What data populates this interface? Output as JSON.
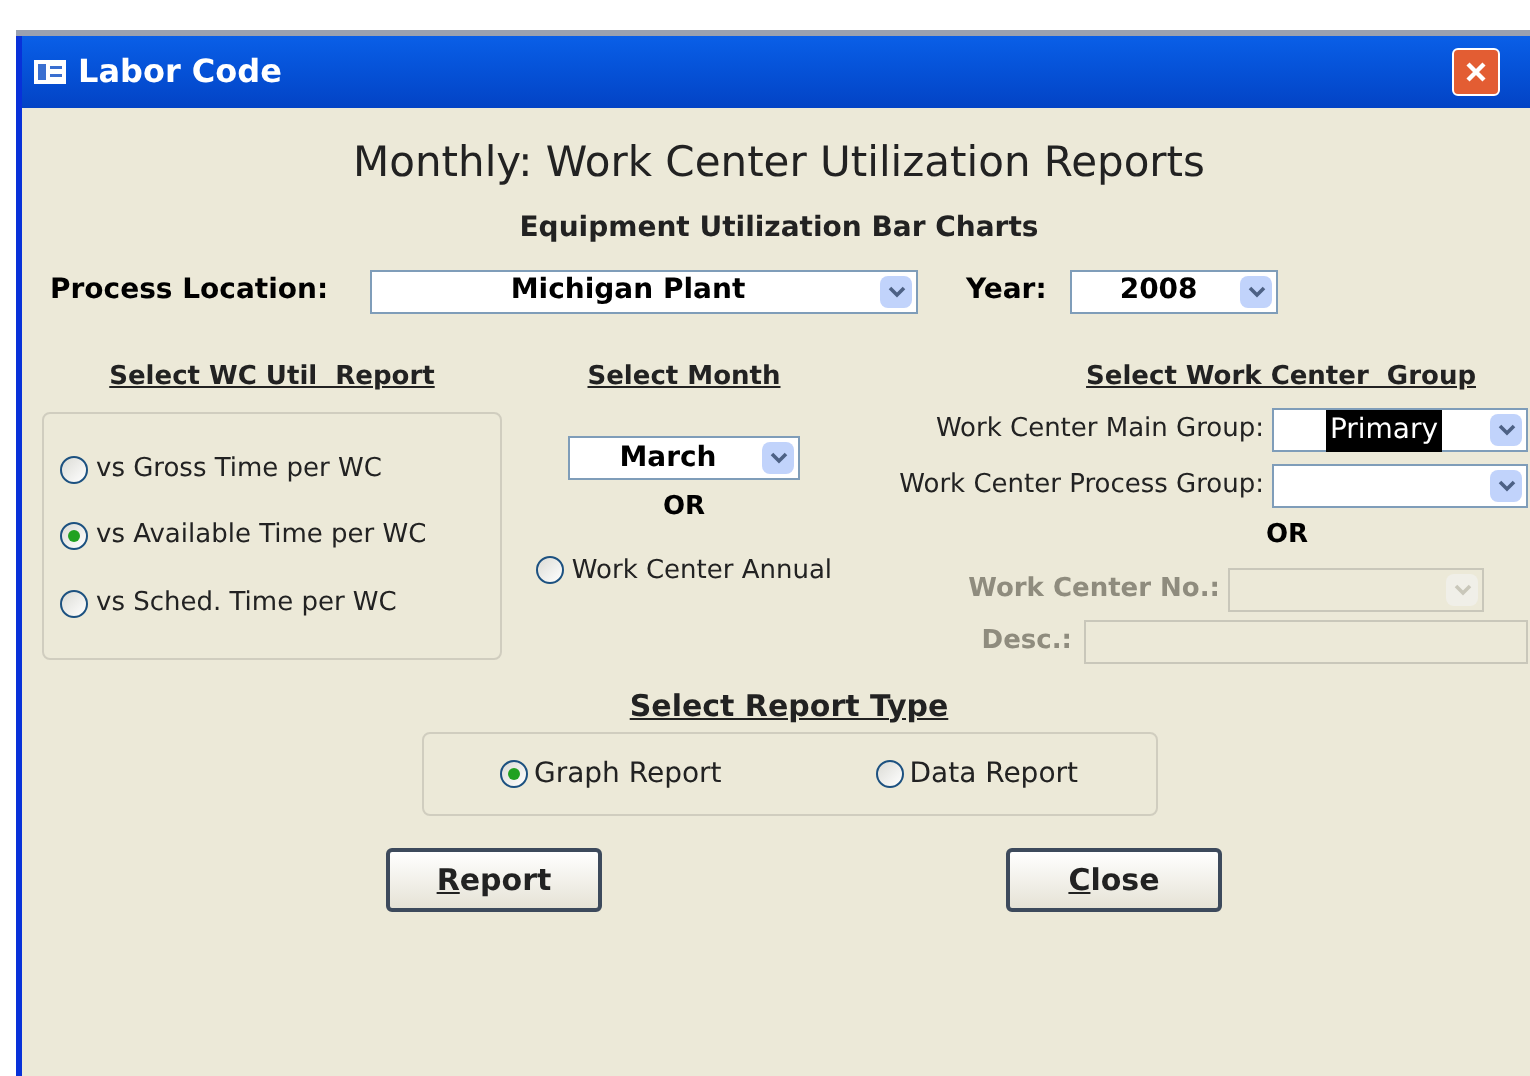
{
  "window": {
    "title": "Labor Code"
  },
  "heading": "Monthly: Work Center Utilization Reports",
  "subheading": "Equipment Utilization Bar Charts",
  "process_location": {
    "label": "Process Location:",
    "value": "Michigan Plant"
  },
  "year": {
    "label": "Year:",
    "value": "2008"
  },
  "wc_util_report": {
    "title": "Select WC Util  Report",
    "options": [
      {
        "label": "vs Gross Time per WC",
        "selected": false
      },
      {
        "label": "vs Available Time per WC",
        "selected": true
      },
      {
        "label": "vs Sched. Time per WC",
        "selected": false
      }
    ]
  },
  "month": {
    "title": "Select Month",
    "value": "March",
    "or": "OR",
    "annual": {
      "label": "Work Center Annual",
      "selected": false
    }
  },
  "work_center_group": {
    "title": "Select Work Center  Group",
    "fields": [
      {
        "label": "Work Center Main Group:",
        "value": "Primary",
        "highlighted": true
      },
      {
        "label": "Work Center Process Group:"
      }
    ],
    "or": "OR",
    "number": {
      "label": "Work Center No.:",
      "disabled": true
    },
    "desc": {
      "label": "Desc.:",
      "disabled": true
    }
  },
  "report_type": {
    "title": "Select Report Type",
    "options": [
      {
        "label": "Graph Report",
        "selected": true
      },
      {
        "label": "Data Report",
        "selected": false
      }
    ]
  },
  "buttons": [
    {
      "accel": "R",
      "rest": "eport"
    },
    {
      "accel": "C",
      "rest": "lose"
    }
  ]
}
